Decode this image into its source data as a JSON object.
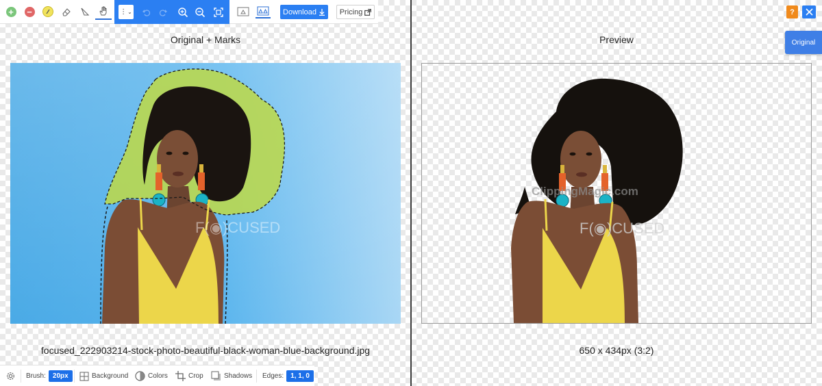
{
  "toolbar": {
    "dropdown_label": "⋮",
    "download_label": "Download",
    "pricing_label": "Pricing"
  },
  "top_right": {
    "help_label": "?",
    "original_label": "Original"
  },
  "left_panel": {
    "heading": "Original + Marks",
    "filename": "focused_222903214-stock-photo-beautiful-black-woman-blue-background.jpg",
    "watermark": "F(◉)CUSED"
  },
  "right_panel": {
    "heading": "Preview",
    "dimensions": "650 x 434px (3:2)",
    "watermark_top": "ClippingMagic.com",
    "watermark": "F(◉)CUSED"
  },
  "bottom_bar": {
    "brush_label": "Brush:",
    "brush_value": "20px",
    "background_label": "Background",
    "colors_label": "Colors",
    "crop_label": "Crop",
    "shadows_label": "Shadows",
    "edges_label": "Edges:",
    "edges_value": "1, 1, 0"
  },
  "colors": {
    "accent_blue": "#2b7ff2",
    "help_orange": "#f08a1c",
    "keep_green": "#7bc67b",
    "remove_red": "#e06666",
    "hair_yellow": "#e6d94a"
  }
}
